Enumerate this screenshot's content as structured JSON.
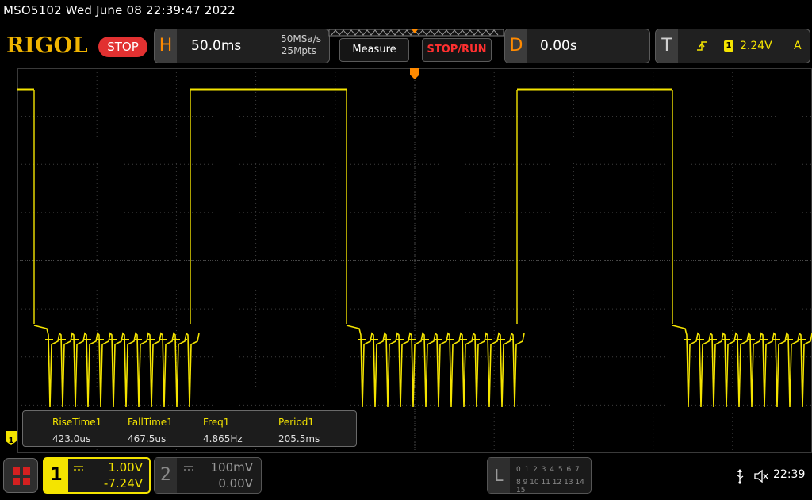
{
  "title_line": "MSO5102  Wed June 08 22:39:47 2022",
  "logo": "RIGOL",
  "run_state": "STOP",
  "horizontal": {
    "letter": "H",
    "timebase": "50.0ms",
    "sample_rate": "50MSa/s",
    "memory_depth": "25Mpts"
  },
  "buttons": {
    "measure": "Measure",
    "stop_run": "STOP/RUN"
  },
  "delay": {
    "letter": "D",
    "value": "0.00s"
  },
  "trigger": {
    "letter": "T",
    "channel": "1",
    "level": "2.24V",
    "mode": "A"
  },
  "measurements": {
    "headers": [
      "RiseTime1",
      "FallTime1",
      "Freq1",
      "Period1"
    ],
    "values": [
      "423.0us",
      "467.5us",
      "4.865Hz",
      "205.5ms"
    ]
  },
  "channel1": {
    "number": "1",
    "scale": "1.00V",
    "offset": "-7.24V",
    "marker": "1"
  },
  "channel2": {
    "number": "2",
    "scale": "100mV",
    "offset": "0.00V"
  },
  "logic": {
    "letter": "L",
    "row1": "0 1 2 3  4 5 6 7",
    "row2": "8 9 10 11 12 13 14 15"
  },
  "status": {
    "clock": "22:39"
  },
  "colors": {
    "trace": "#f4e400",
    "accent_orange": "#ff8a00",
    "stop_red": "#e23131",
    "logo": "#f0b400"
  },
  "icons": [
    "menu-grid-icon",
    "usb-icon",
    "speaker-muted-icon",
    "trigger-edge-icon",
    "trigger-position-icon"
  ]
}
